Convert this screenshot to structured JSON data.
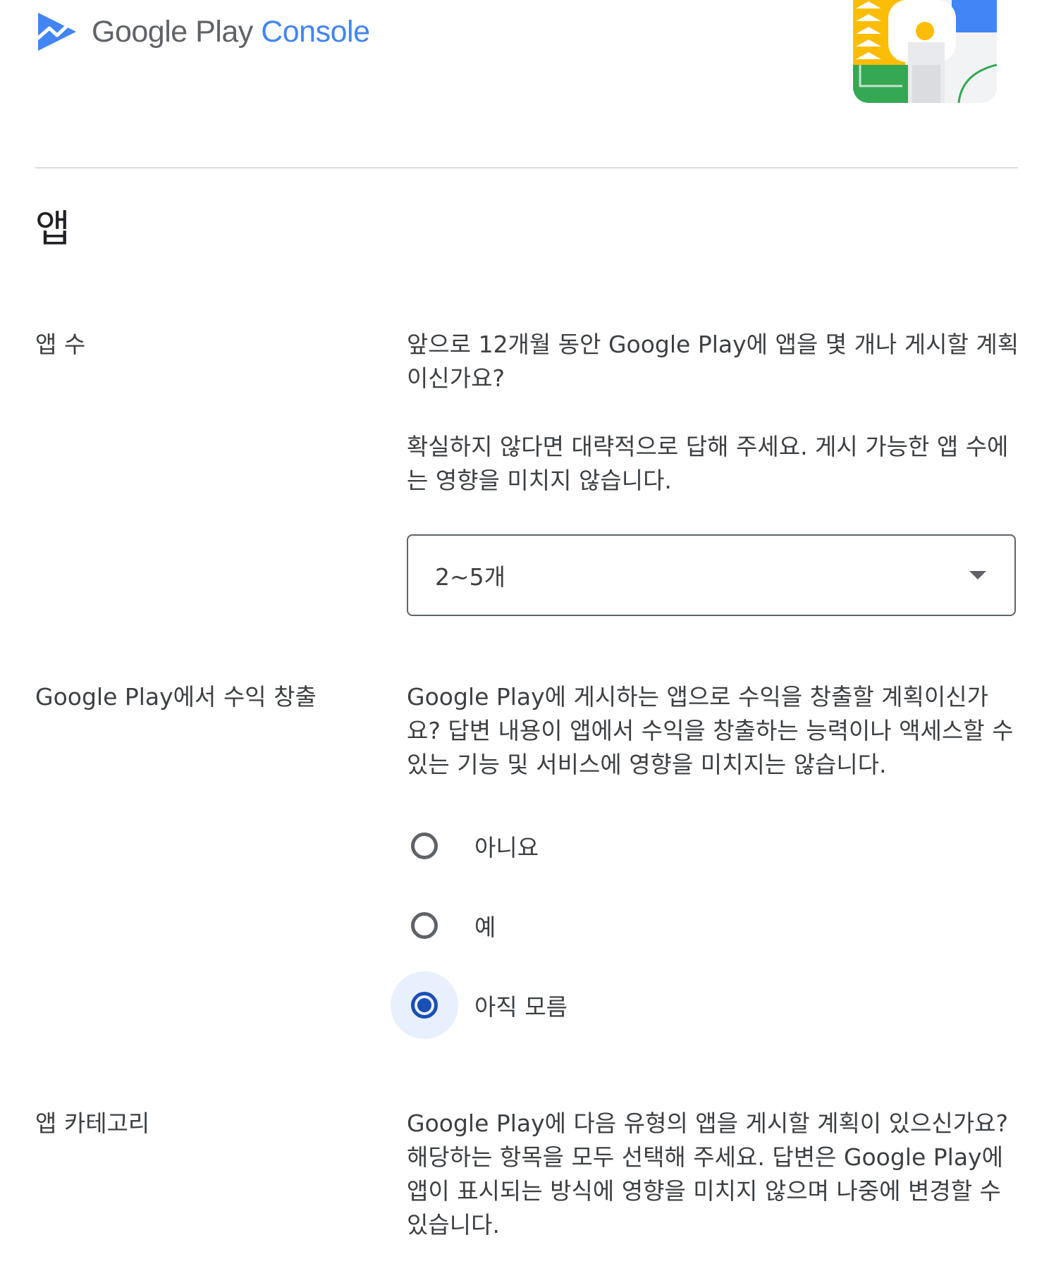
{
  "header": {
    "logo_google": "Google Play",
    "logo_console": "Console"
  },
  "section": {
    "title": "앱"
  },
  "app_count": {
    "label": "앱 수",
    "question": "앞으로 12개월 동안 Google Play에 앱을 몇 개나 게시할 계획이신가요?",
    "hint": "확실하지 않다면 대략적으로 답해 주세요. 게시 가능한 앱 수에는 영향을 미치지 않습니다.",
    "selected": "2~5개"
  },
  "monetization": {
    "label": "Google Play에서 수익 창출",
    "question": "Google Play에 게시하는 앱으로 수익을 창출할 계획이신가요? 답변 내용이 앱에서 수익을 창출하는 능력이나 액세스할 수 있는 기능 및 서비스에 영향을 미치지는 않습니다.",
    "options": [
      {
        "label": "아니요",
        "selected": false
      },
      {
        "label": "예",
        "selected": false
      },
      {
        "label": "아직 모름",
        "selected": true
      }
    ]
  },
  "app_category": {
    "label": "앱 카테고리",
    "question": "Google Play에 다음 유형의 앱을 게시할 계획이 있으신가요? 해당하는 항목을 모두 선택해 주세요. 답변은 Google Play에 앱이 표시되는 방식에 영향을 미치지 않으며 나중에 변경할 수 있습니다."
  },
  "colors": {
    "accent": "#1a4fb5",
    "console_blue": "#4285f4",
    "text": "#3c4043",
    "divider": "#dadce0"
  },
  "icons": [
    "play-console-logo-icon",
    "dropdown-arrow-icon",
    "radio-icon"
  ]
}
